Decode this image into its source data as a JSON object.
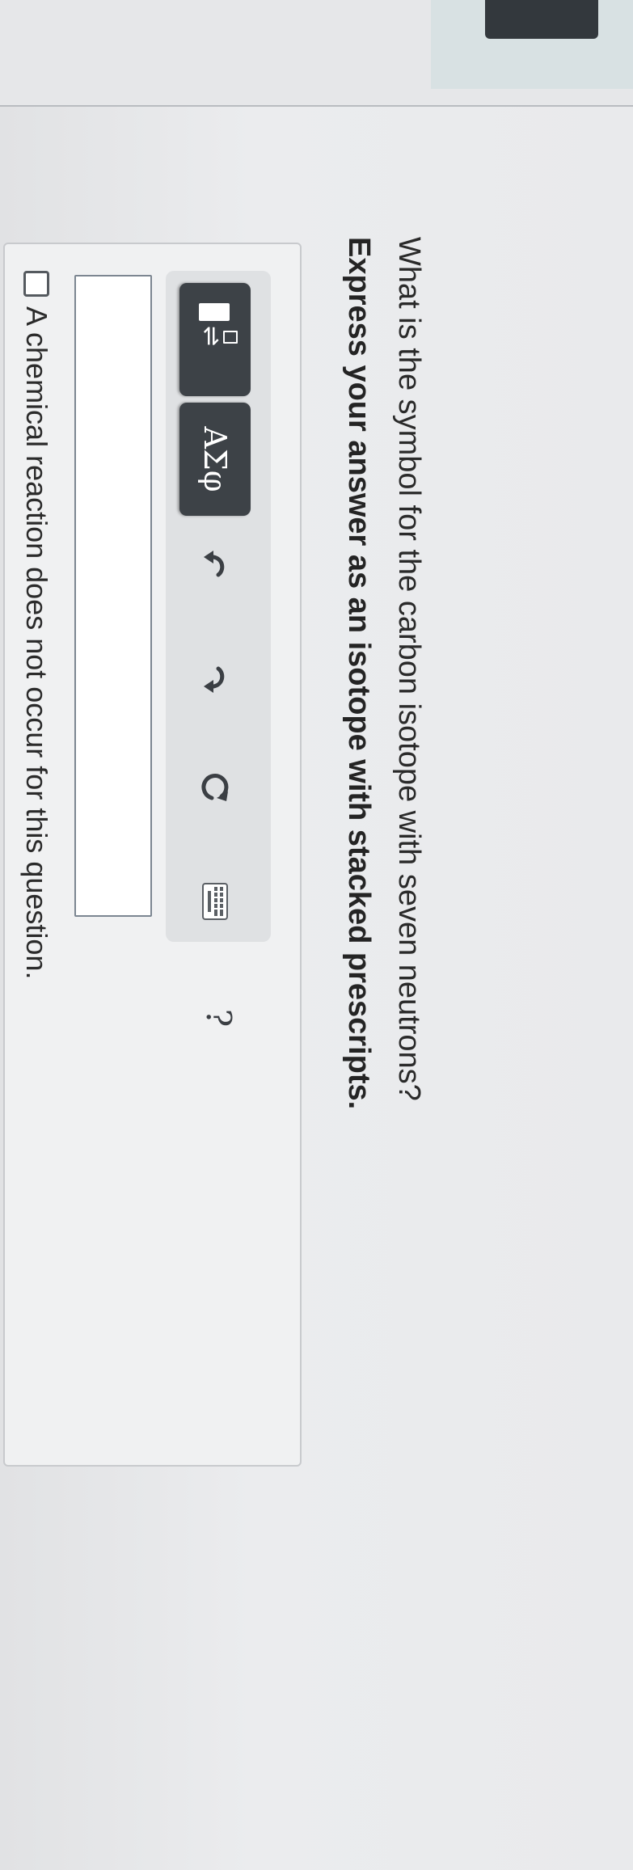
{
  "question": {
    "prompt": "What is the symbol for the carbon isotope with seven neutrons?",
    "instruction": "Express your answer as an isotope with stacked prescripts."
  },
  "toolbar": {
    "template_button_icon": "stacked-prescript-template-icon",
    "symbols_label": "ΑΣφ",
    "undo_icon": "undo-arrow-icon",
    "redo_icon": "redo-arrow-icon",
    "reset_icon": "reset-circle-arrow-icon",
    "keyboard_icon": "keyboard-icon",
    "help_label": "?"
  },
  "answer": {
    "value": ""
  },
  "no_reaction_option": {
    "label": "A chemical reaction does not occur for this question.",
    "checked": false
  },
  "colors": {
    "button_dark": "#3d4247",
    "toolbar_bg": "#dfe1e3",
    "input_border": "#7c8691"
  }
}
